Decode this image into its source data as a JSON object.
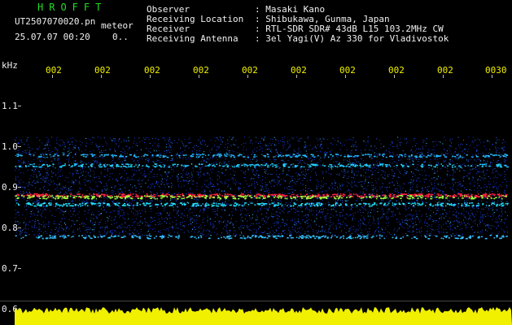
{
  "header": {
    "brand": "HROFFT",
    "filename": "UT2507070020.pn",
    "meteor_label": "meteor",
    "datetime": "25.07.07 00:20",
    "count": "0.."
  },
  "info": {
    "labels": [
      "Observer",
      "Receiving Location",
      "Receiver",
      "Receiving Antenna"
    ],
    "values": [
      ": Masaki Kano",
      ": Shibukawa, Gunma, Japan",
      ": RTL-SDR SDR# 43dB L15 103.2MHz CW",
      ": 3el Yagi(V) Az 330 for Vladivostok"
    ]
  },
  "axes": {
    "y_unit": "kHz",
    "y_ticks": [
      "1.1",
      "1.0",
      "0.9",
      "0.8",
      "0.7",
      "0.6"
    ],
    "x_ticks": [
      "002",
      "002",
      "002",
      "002",
      "002",
      "002",
      "002",
      "002",
      "002",
      "0030"
    ]
  },
  "colors": {
    "background": "#000000",
    "noise": "#1a3cff",
    "signal": "#00e0ff",
    "strong": "#ff2040",
    "power": "#f0f000"
  }
}
